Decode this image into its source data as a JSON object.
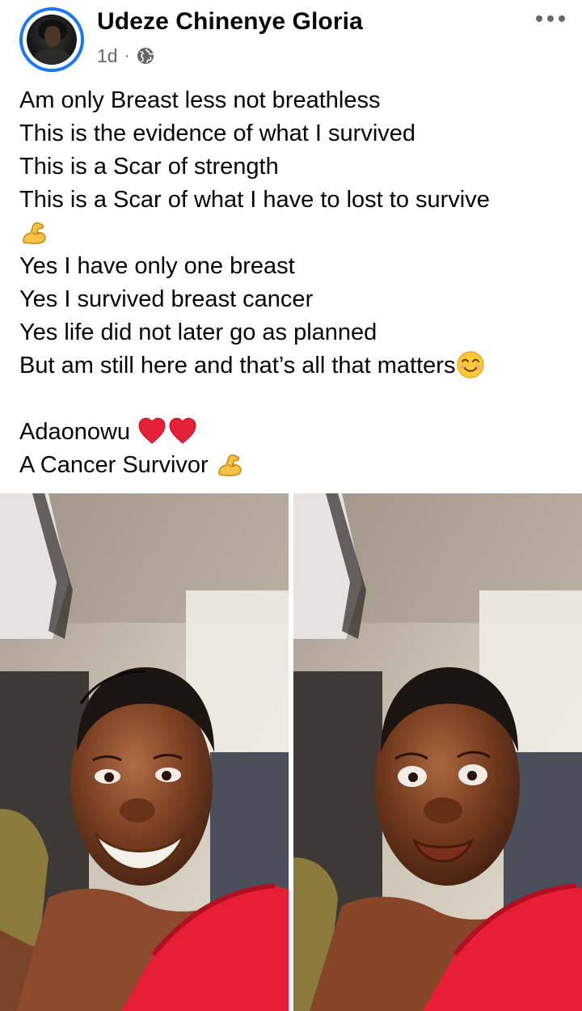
{
  "post": {
    "author": "Udeze Chinenye Gloria",
    "time": "1d",
    "separator": "·",
    "lines": [
      "Am only Breast less not breathless",
      "This is the evidence of what I survived",
      "This is a Scar of strength",
      "This is a Scar of what I have to lost to survive",
      "",
      "Yes I have only one breast",
      "Yes I survived breast cancer",
      "Yes life did not later go as planned",
      "But am still here and that’s all that matters",
      "",
      "Adaonowu ",
      "A Cancer Survivor "
    ]
  },
  "icons": {
    "privacy": "globe-icon",
    "more": "more-options-icon",
    "emoji_strength": "flexed-biceps-emoji",
    "emoji_smile": "smiling-face-emoji",
    "emoji_heart": "red-heart-emoji"
  },
  "colors": {
    "avatar_ring": "#1877f2",
    "secondary_text": "#65676b",
    "primary_text": "#050505"
  }
}
